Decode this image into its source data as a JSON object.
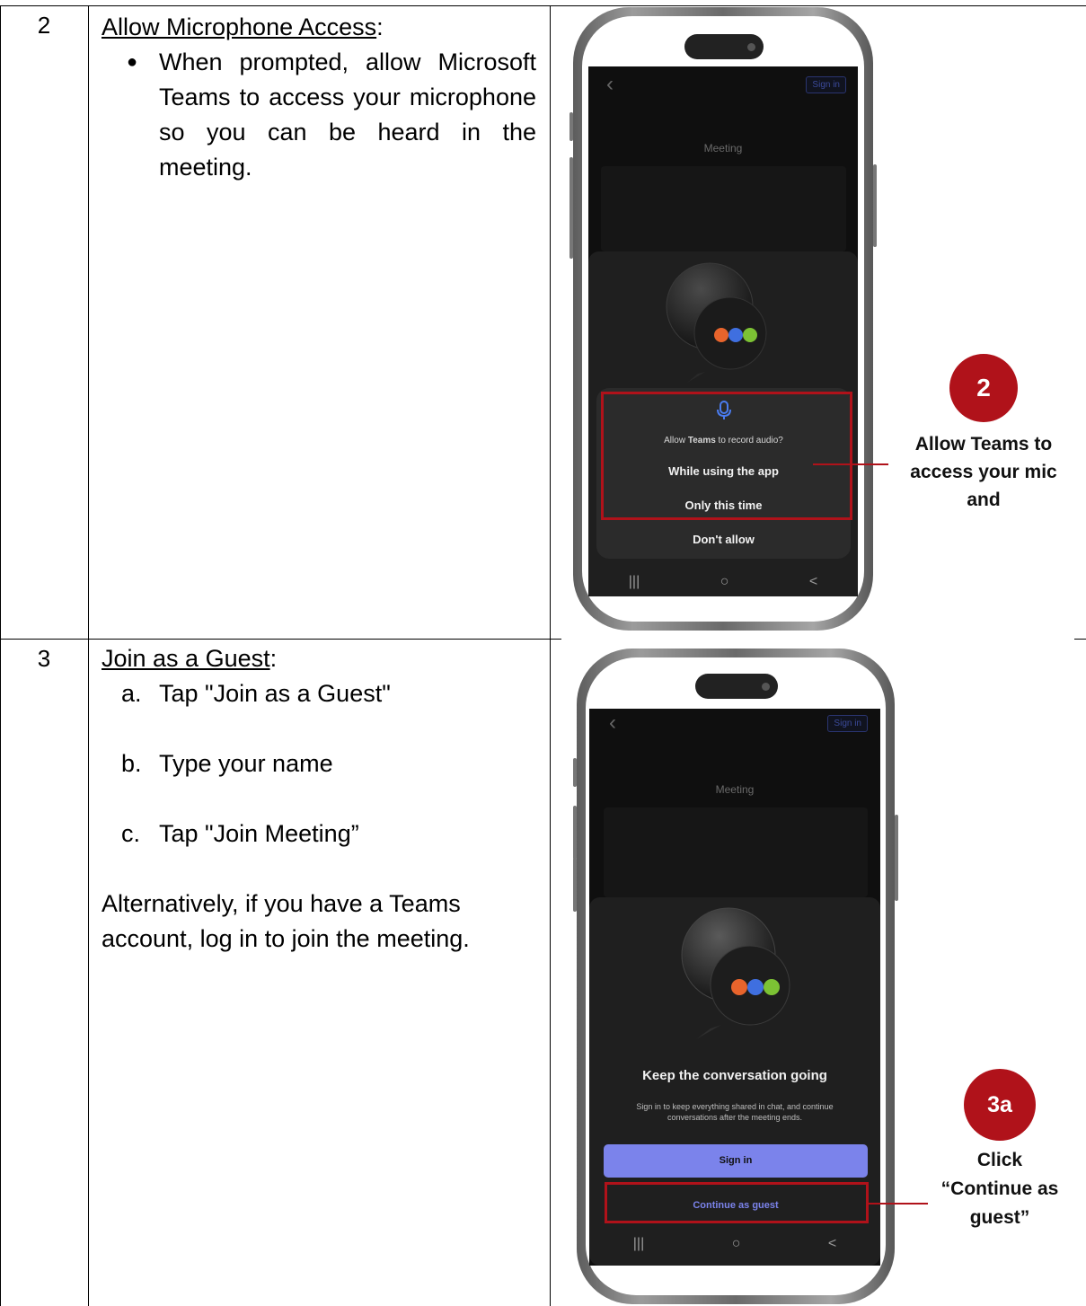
{
  "steps": [
    {
      "number": "2",
      "heading": "Allow Microphone Access",
      "heading_suffix": ":",
      "bullet": "When prompted, allow Microsoft Teams to access your microphone so you can be heard in the meeting."
    },
    {
      "number": "3",
      "heading": "Join as a Guest",
      "heading_suffix": ":",
      "items": [
        {
          "marker": "a.",
          "text": "Tap \"Join as a Guest\""
        },
        {
          "marker": "b.",
          "text": "Type your name"
        },
        {
          "marker": "c.",
          "text": "Tap \"Join Meeting”"
        }
      ],
      "note": "Alternatively, if you have a Teams account, log in to join the meeting."
    }
  ],
  "phone1": {
    "sign_in": "Sign in",
    "meeting": "Meeting",
    "dialog": {
      "app_name": "Teams",
      "question_prefix": "Allow ",
      "question_suffix": " to record audio?",
      "option_1": "While using the app",
      "option_2": "Only this time",
      "option_3": "Don't allow"
    },
    "nav": [
      "|||",
      "○",
      "<"
    ]
  },
  "phone2": {
    "sign_in": "Sign in",
    "meeting": "Meeting",
    "title": "Keep the conversation going",
    "subtitle_1": "Sign in to keep everything shared in chat, and continue",
    "subtitle_2": "conversations after the meeting ends.",
    "signin_button": "Sign in",
    "guest_button": "Continue as guest",
    "nav": [
      "|||",
      "○",
      "<"
    ]
  },
  "callouts": [
    {
      "badge": "2",
      "line_1": "Allow Teams to",
      "line_2": "access your mic",
      "line_3": "and"
    },
    {
      "badge": "3a",
      "line_1": "Click",
      "line_2": "“Continue as",
      "line_3": "guest”"
    }
  ],
  "colors": {
    "accent_red": "#b0121a",
    "teams_purple": "#7b83eb",
    "mic_blue": "#4a7cf0"
  }
}
